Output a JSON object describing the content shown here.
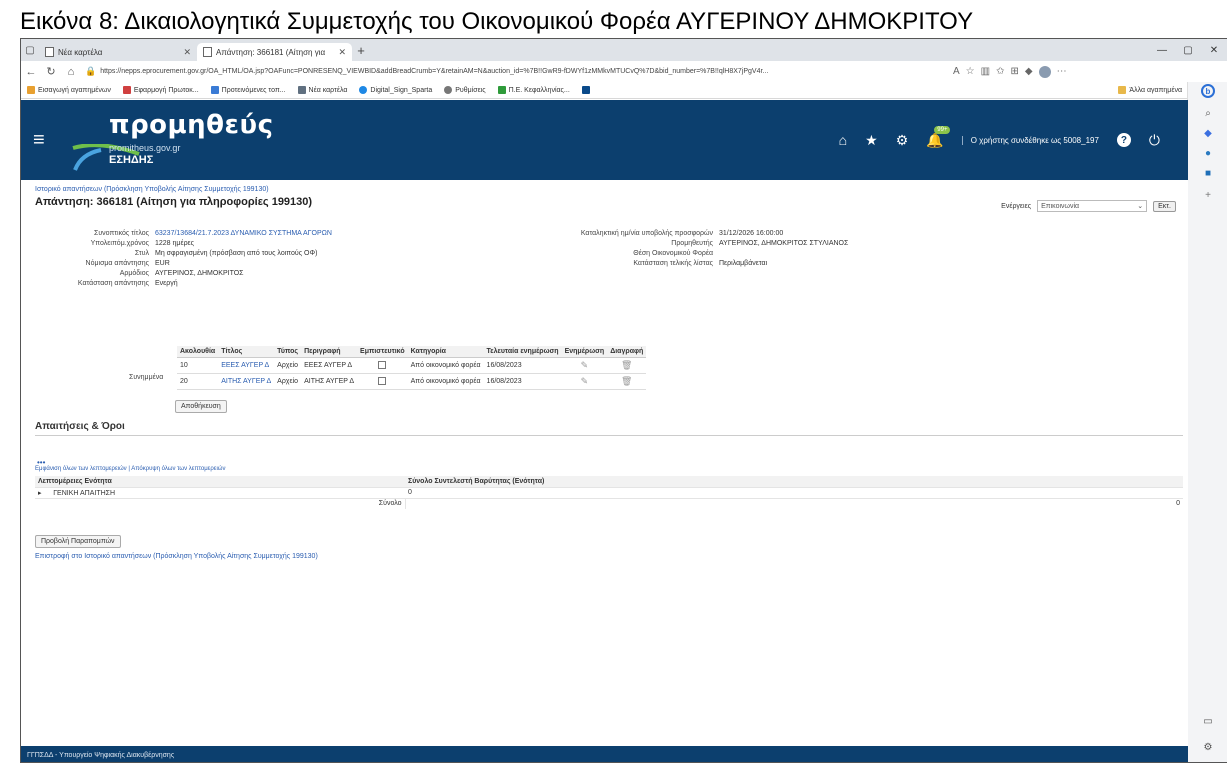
{
  "caption": "Εικόνα 8: Δικαιολογητικά Συμμετοχής του Οικονομικού Φορέα ΑΥΓΕΡΙΝΟΥ ΔΗΜΟΚΡΙΤΟΥ",
  "browser": {
    "tabs": [
      {
        "label": "Νέα καρτέλα"
      },
      {
        "label": "Απάντηση: 366181 (Αίτηση για"
      }
    ],
    "url": "https://nepps.eprocurement.gov.gr/OA_HTML/OA.jsp?OAFunc=PONRESENQ_VIEWBID&addBreadCrumb=Y&retainAM=N&auction_id=%7B!!GwR9-fDWYf1zMMkvMTUCvQ%7D&bid_number=%7B!!qlH8X7jPgV4r...",
    "bookmarks": [
      {
        "label": "Εισαγωγή αγαπημένων",
        "color": "#e8a030"
      },
      {
        "label": "Εφαρμογή Πρωτοκ...",
        "color": "#d04040"
      },
      {
        "label": "Προτεινόμενες τοπ...",
        "color": "#3a7bd5"
      },
      {
        "label": "Νέα καρτέλα",
        "color": "#607080"
      },
      {
        "label": "Digital_Sign_Sparta",
        "color": "#1e88e5"
      },
      {
        "label": "Ρυθμίσεις",
        "color": "#777777"
      },
      {
        "label": "Π.Ε. Κεφαλληνίας...",
        "color": "#2e9b3a"
      },
      {
        "label": "",
        "color": "#0a4a8a"
      }
    ],
    "bookmarks_right": "Άλλα αγαπημένα"
  },
  "app": {
    "logo_name": "προμηθεύς",
    "logo_sub": "promitheus.gov.gr",
    "logo_esidis": "ΕΣΗΔΗΣ",
    "notif_count": "99+",
    "user_text": "Ο χρήστης συνδέθηκε ως 5008_197"
  },
  "page": {
    "breadcrumb": "Ιστορικό απαντήσεων (Πρόσκληση Υποβολής Αίτησης Συμμετοχής 199130)",
    "title": "Απάντηση: 366181 (Αίτηση για πληροφορίες 199130)",
    "actions_label": "Ενέργειες",
    "actions_value": "Επικοινωνία",
    "go_label": "Εκτ.",
    "left_fields": [
      {
        "k": "Συνοπτικός τίτλος",
        "v": "63237/13684/21.7.2023 ΔΥΝΑΜΙΚΟ ΣΥΣΤΗΜΑ ΑΓΟΡΩΝ",
        "link": true
      },
      {
        "k": "Υπολειπόμ.χρόνος",
        "v": "1228 ημέρες",
        "link": false
      },
      {
        "k": "Στυλ",
        "v": "Μη σφραγισμένη (πρόσβαση από τους λοιπούς ΟΦ)",
        "link": false
      },
      {
        "k": "Νόμισμα απάντησης",
        "v": "EUR",
        "link": false
      },
      {
        "k": "Αρμόδιος",
        "v": "ΑΥΓΕΡΙΝΟΣ, ΔΗΜΟΚΡΙΤΟΣ",
        "link": false
      },
      {
        "k": "Κατάσταση απάντησης",
        "v": "Ενεργή",
        "link": false
      }
    ],
    "right_fields": [
      {
        "k": "Καταληκτική ημ/νία υποβολής προσφορών",
        "v": "31/12/2026 16:00:00"
      },
      {
        "k": "Προμηθευτής",
        "v": "ΑΥΓΕΡΙΝΟΣ, ΔΗΜΟΚΡΙΤΟΣ ΣΤΥΛΙΑΝΟΣ"
      },
      {
        "k": "Θέση Οικονομικού Φορέα",
        "v": ""
      },
      {
        "k": "Κατάσταση τελικής λίστας",
        "v": "Περιλαμβάνεται"
      }
    ],
    "attachments_label": "Συνημμένα",
    "attachments_headers": [
      "Ακολουθία",
      "Τίτλος",
      "Τύπος",
      "Περιγραφή",
      "Εμπιστευτικό",
      "Κατηγορία",
      "Τελευταία ενημέρωση",
      "Ενημέρωση",
      "Διαγραφή"
    ],
    "attachments_rows": [
      {
        "seq": "10",
        "title": "ΕΕΕΣ ΑΥΓΕΡ Δ",
        "type": "Αρχείο",
        "desc": "ΕΕΕΣ ΑΥΓΕΡ Δ",
        "cat": "Από οικονομικό φορέα",
        "updated": "16/08/2023"
      },
      {
        "seq": "20",
        "title": "ΑΙΤΗΣ ΑΥΓΕΡ Δ",
        "type": "Αρχείο",
        "desc": "ΑΙΤΗΣ ΑΥΓΕΡ Δ",
        "cat": "Από οικονομικό φορέα",
        "updated": "16/08/2023"
      }
    ],
    "save_label": "Αποθήκευση",
    "req_section": "Απαιτήσεις & Όροι",
    "req_dots": "•••",
    "req_links": "Εμφάνιση όλων των λεπτομερειών | Απόκρυψη όλων των λεπτομερειών",
    "req_headers": [
      "Λεπτομέρειες",
      "Ενότητα",
      "Σύνολο Συντελεστή Βαρύτητας (Ενότητα)"
    ],
    "req_row_section": "ΓΕΝΙΚΗ ΑΠΑΙΤΗΣΗ",
    "req_row_value": "0",
    "req_total_label": "Σύνολο",
    "req_total_value": "0",
    "attachments_btn": "Προβολή Παραπομπών",
    "back_link": "Επιστροφή στο Ιστορικό απαντήσεων (Πρόσκληση Υποβολής Αίτησης Συμμετοχής 199130)"
  },
  "footer": "ΓΓΠΣΔΔ - Υπουργείο Ψηφιακής Διακυβέρνησης"
}
